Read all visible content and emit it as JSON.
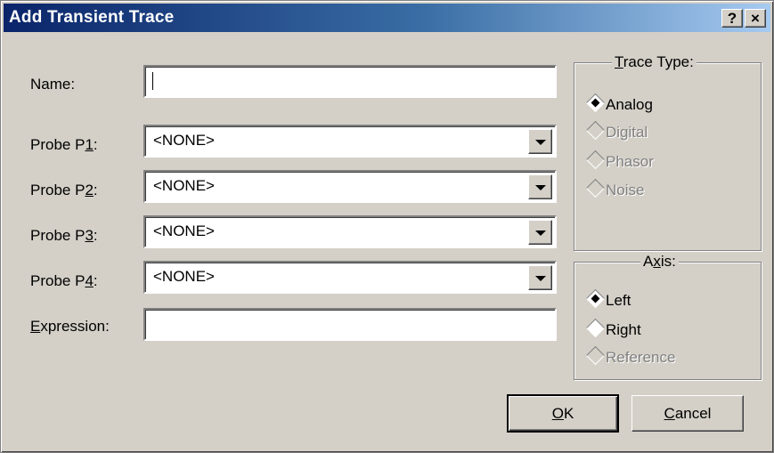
{
  "window": {
    "title": "Add Transient Trace",
    "help_glyph": "?",
    "close_glyph": "×"
  },
  "form": {
    "name_label": "Name:",
    "name_value": "",
    "probe1_label_pre": "Probe P",
    "probe1_label_key": "1",
    "probe1_label_post": ":",
    "probe1_value": "<NONE>",
    "probe2_label_pre": "Probe P",
    "probe2_label_key": "2",
    "probe2_label_post": ":",
    "probe2_value": "<NONE>",
    "probe3_label_pre": "Probe P",
    "probe3_label_key": "3",
    "probe3_label_post": ":",
    "probe3_value": "<NONE>",
    "probe4_label_pre": "Probe P",
    "probe4_label_key": "4",
    "probe4_label_post": ":",
    "probe4_value": "<NONE>",
    "expression_label_key": "E",
    "expression_label_rest": "xpression:",
    "expression_value": ""
  },
  "trace_type": {
    "title_key": "T",
    "title_rest": "race Type:",
    "options": [
      {
        "label": "Analog",
        "checked": true,
        "enabled": true
      },
      {
        "label": "Digital",
        "checked": false,
        "enabled": false
      },
      {
        "label": "Phasor",
        "checked": false,
        "enabled": false
      },
      {
        "label": "Noise",
        "checked": false,
        "enabled": false
      }
    ]
  },
  "axis": {
    "title_pre": "A",
    "title_key": "x",
    "title_post": "is:",
    "options": [
      {
        "label": "Left",
        "checked": true,
        "enabled": true
      },
      {
        "label": "Right",
        "checked": false,
        "enabled": true
      },
      {
        "label": "Reference",
        "checked": false,
        "enabled": false
      }
    ]
  },
  "buttons": {
    "ok_key": "O",
    "ok_rest": "K",
    "cancel_key": "C",
    "cancel_rest": "ancel"
  }
}
